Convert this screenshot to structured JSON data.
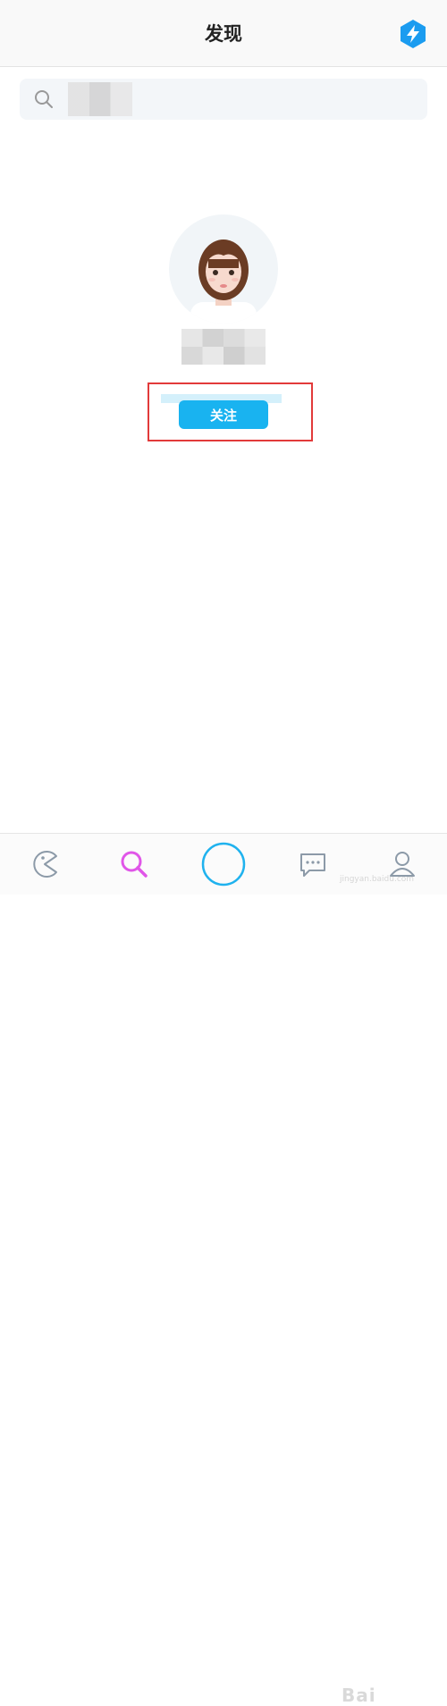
{
  "header": {
    "title": "发现",
    "bolt_icon": "lightning-bolt-icon",
    "accent": "#1b9cf0"
  },
  "search": {
    "value": "",
    "placeholder": "",
    "icon": "search-icon"
  },
  "profile": {
    "follow_label": "关注",
    "follow_color": "#19b3f0"
  },
  "tabbar": {
    "tabs": [
      {
        "name": "home",
        "icon": "pacman-icon"
      },
      {
        "name": "discover",
        "icon": "search-icon",
        "active": true,
        "color": "#e056e8"
      },
      {
        "name": "center",
        "icon": "circle-icon"
      },
      {
        "name": "messages",
        "icon": "chat-bubble-icon"
      },
      {
        "name": "profile",
        "icon": "person-icon"
      }
    ]
  },
  "watermark": {
    "text": "Bai",
    "subtext": "jingyan.baidu.com"
  }
}
